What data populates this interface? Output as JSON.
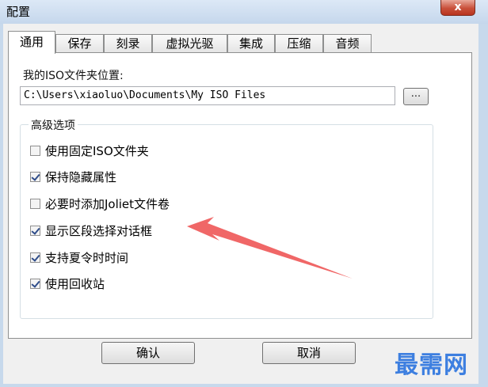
{
  "window": {
    "title": "配置",
    "close_label": "x"
  },
  "tabs": [
    {
      "label": "通用",
      "active": true
    },
    {
      "label": "保存",
      "active": false
    },
    {
      "label": "刻录",
      "active": false
    },
    {
      "label": "虚拟光驱",
      "active": false
    },
    {
      "label": "集成",
      "active": false
    },
    {
      "label": "压缩",
      "active": false
    },
    {
      "label": "音频",
      "active": false
    }
  ],
  "general": {
    "iso_folder_label": "我的ISO文件夹位置:",
    "iso_folder_value": "C:\\Users\\xiaoluo\\Documents\\My ISO Files",
    "browse_label": "...",
    "advanced_title": "高级选项",
    "options": [
      {
        "label": "使用固定ISO文件夹",
        "checked": false
      },
      {
        "label": "保持隐藏属性",
        "checked": true
      },
      {
        "label": "必要时添加Joliet文件卷",
        "checked": false
      },
      {
        "label": "显示区段选择对话框",
        "checked": true
      },
      {
        "label": "支持夏令时时间",
        "checked": true
      },
      {
        "label": "使用回收站",
        "checked": true
      }
    ]
  },
  "buttons": {
    "ok_label": "确认",
    "cancel_label": "取消"
  },
  "watermark": {
    "text": "最需网"
  },
  "colors": {
    "annotation_arrow": "#ef5a5a",
    "watermark": "#3d7fe0"
  }
}
